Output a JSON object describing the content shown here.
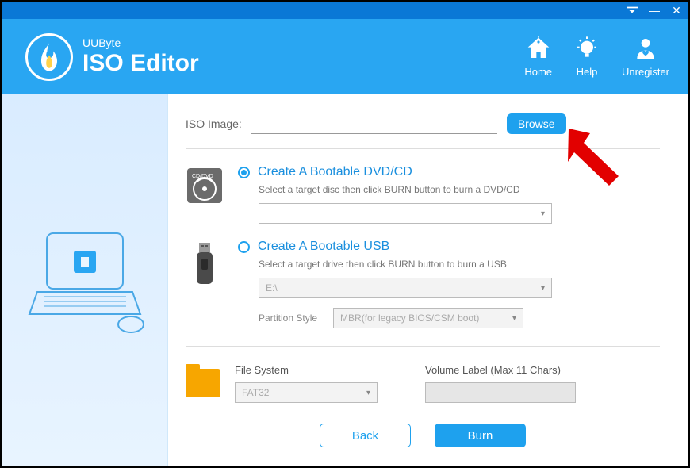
{
  "titlebar": {
    "dropdown": "▾",
    "minimize": "—",
    "close": "✕"
  },
  "brand": {
    "small": "UUByte",
    "big": "ISO Editor"
  },
  "nav": {
    "home": "Home",
    "help": "Help",
    "unregister": "Unregister"
  },
  "iso": {
    "label": "ISO Image:",
    "value": "",
    "browse": "Browse"
  },
  "option_dvd": {
    "title": "Create A Bootable DVD/CD",
    "desc": "Select a target disc then click BURN button to burn a DVD/CD",
    "select_value": ""
  },
  "option_usb": {
    "title": "Create A Bootable USB",
    "desc": "Select a target drive then click BURN button to burn a USB",
    "drive": "E:\\",
    "partition_label": "Partition Style",
    "partition_value": "MBR(for legacy BIOS/CSM boot)"
  },
  "fs": {
    "fs_label": "File System",
    "fs_value": "FAT32",
    "vol_label": "Volume Label (Max 11 Chars)",
    "vol_value": ""
  },
  "actions": {
    "back": "Back",
    "burn": "Burn"
  }
}
